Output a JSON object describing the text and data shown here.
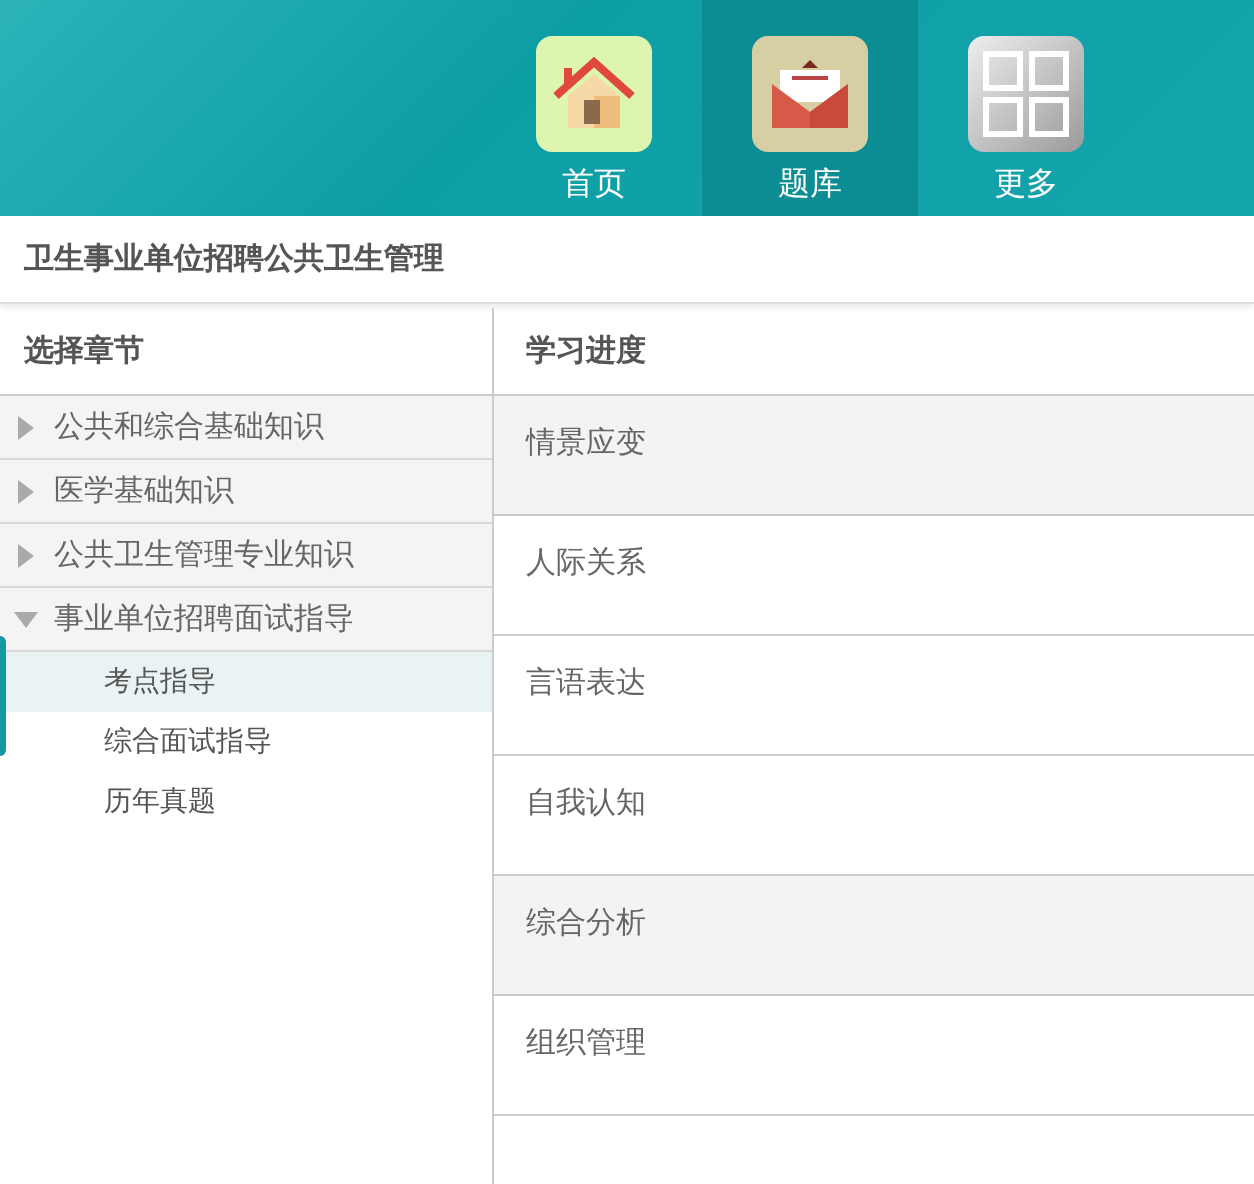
{
  "nav": [
    {
      "label": "首页",
      "kind": "home",
      "selected": false
    },
    {
      "label": "题库",
      "kind": "mail",
      "selected": true
    },
    {
      "label": "更多",
      "kind": "grid",
      "selected": false
    }
  ],
  "page_title": "卫生事业单位招聘公共卫生管理",
  "chapters": {
    "heading": "选择章节",
    "items": [
      {
        "label": "公共和综合基础知识",
        "expanded": false
      },
      {
        "label": "医学基础知识",
        "expanded": false
      },
      {
        "label": "公共卫生管理专业知识",
        "expanded": false
      },
      {
        "label": "事业单位招聘面试指导",
        "expanded": true,
        "children": [
          {
            "label": "考点指导",
            "selected": true
          },
          {
            "label": "综合面试指导",
            "selected": false
          },
          {
            "label": "历年真题",
            "selected": false
          }
        ]
      }
    ]
  },
  "progress": {
    "heading": "学习进度",
    "items": [
      {
        "label": "情景应变",
        "shaded": true
      },
      {
        "label": "人际关系",
        "shaded": false
      },
      {
        "label": "言语表达",
        "shaded": false
      },
      {
        "label": "自我认知",
        "shaded": false
      },
      {
        "label": "综合分析",
        "shaded": true
      },
      {
        "label": "组织管理",
        "shaded": false
      }
    ]
  }
}
